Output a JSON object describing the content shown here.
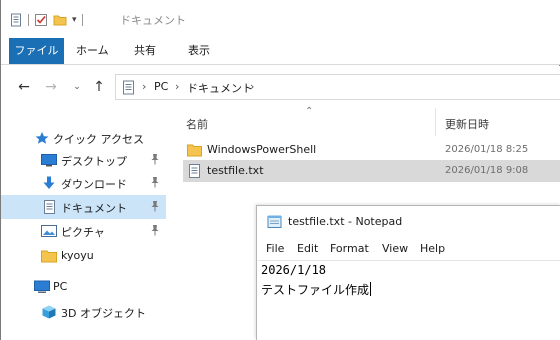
{
  "window": {
    "title": "ドキュメント"
  },
  "ribbon": {
    "tabs": [
      {
        "label": "ファイル"
      },
      {
        "label": "ホーム"
      },
      {
        "label": "共有"
      },
      {
        "label": "表示"
      }
    ]
  },
  "address": {
    "crumbs": [
      "PC",
      "ドキュメント"
    ]
  },
  "nav": {
    "items": [
      {
        "label": "クイック アクセス",
        "icon": "star-icon"
      },
      {
        "label": "デスクトップ",
        "icon": "desktop-icon",
        "pinned": true
      },
      {
        "label": "ダウンロード",
        "icon": "download-arrow-icon",
        "pinned": true
      },
      {
        "label": "ドキュメント",
        "icon": "document-icon",
        "pinned": true,
        "selected": true
      },
      {
        "label": "ピクチャ",
        "icon": "pictures-icon",
        "pinned": true
      },
      {
        "label": "kyoyu",
        "icon": "folder-icon"
      },
      {
        "label": "PC",
        "icon": "computer-icon"
      },
      {
        "label": "3D オブジェクト",
        "icon": "cube-3d-icon"
      }
    ]
  },
  "content": {
    "columns": {
      "name": "名前",
      "date": "更新日時"
    },
    "files": [
      {
        "name": "WindowsPowerShell",
        "date": "2026/01/18 8:25",
        "icon": "folder-icon"
      },
      {
        "name": "testfile.txt",
        "date": "2026/01/18 9:08",
        "icon": "text-file-icon",
        "selected": true
      }
    ]
  },
  "notepad": {
    "title": "testfile.txt - Notepad",
    "menu": [
      "File",
      "Edit",
      "Format",
      "View",
      "Help"
    ],
    "lines": [
      "2026/1/18",
      "テストファイル作成"
    ]
  },
  "colors": {
    "file_tab": "#1b6fb5",
    "nav_selected": "#cce4f7",
    "row_selected": "#d9d9d9",
    "folder": "#f4c44e"
  }
}
